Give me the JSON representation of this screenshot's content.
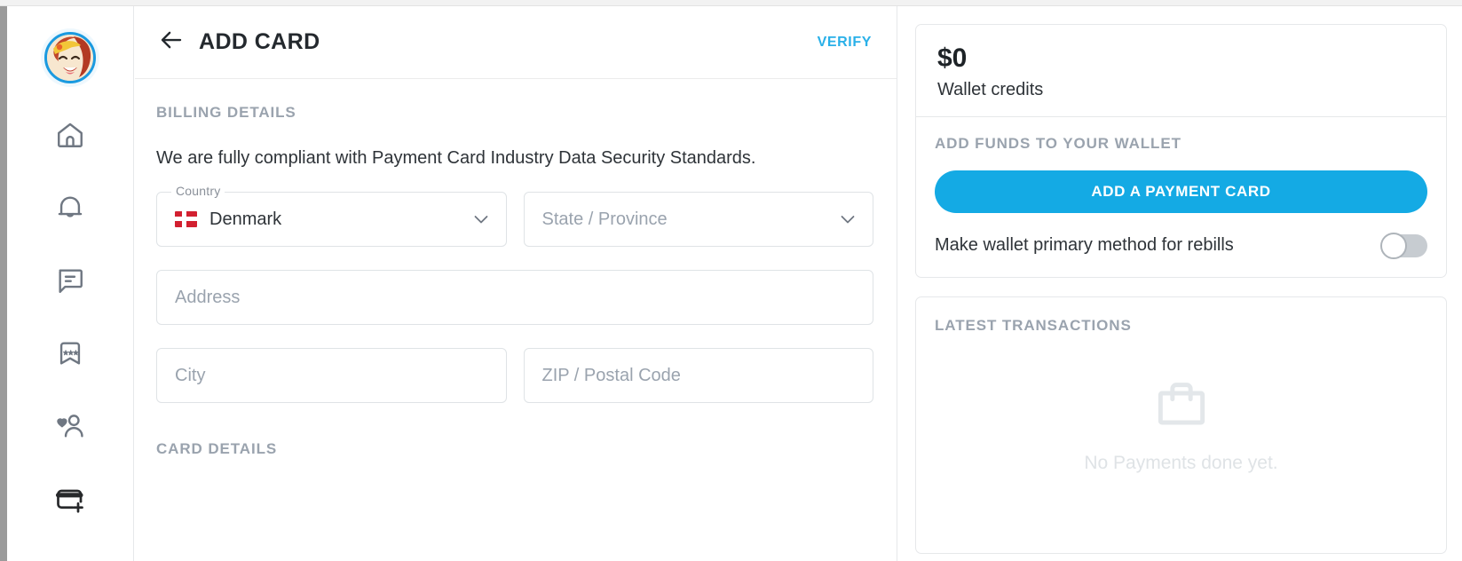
{
  "sidebar": {
    "avatar": {
      "name": "user-avatar",
      "alt": "User profile avatar"
    },
    "items": [
      {
        "icon": "home-icon",
        "name": "sidebar-item-home",
        "active": false
      },
      {
        "icon": "bell-icon",
        "name": "sidebar-item-notifications",
        "active": false
      },
      {
        "icon": "chat-icon",
        "name": "sidebar-item-messages",
        "active": false
      },
      {
        "icon": "bookmark-stars-icon",
        "name": "sidebar-item-favorites",
        "active": false
      },
      {
        "icon": "person-heart-icon",
        "name": "sidebar-item-friends",
        "active": false
      },
      {
        "icon": "credit-card-add-icon",
        "name": "sidebar-item-payments",
        "active": true
      }
    ]
  },
  "header": {
    "back_icon": "back-arrow-icon",
    "title": "ADD CARD",
    "verify_label": "VERIFY"
  },
  "billing": {
    "section_label": "BILLING DETAILS",
    "compliance_text": "We are fully compliant with Payment Card Industry Data Security Standards.",
    "country": {
      "label": "Country",
      "value": "Denmark",
      "flag": "denmark-flag-icon",
      "chevron": "chevron-down-icon"
    },
    "state": {
      "placeholder": "State / Province",
      "chevron": "chevron-down-icon"
    },
    "address": {
      "placeholder": "Address"
    },
    "city": {
      "placeholder": "City"
    },
    "zip": {
      "placeholder": "ZIP / Postal Code"
    },
    "card_details_label": "CARD DETAILS"
  },
  "wallet": {
    "amount": "$0",
    "credits_label": "Wallet credits",
    "add_funds_label": "ADD FUNDS TO YOUR WALLET",
    "add_card_button": "ADD A PAYMENT CARD",
    "primary_toggle_label": "Make wallet primary method for rebills",
    "primary_toggle_state": "off"
  },
  "transactions": {
    "heading": "LATEST TRANSACTIONS",
    "empty_icon": "shopping-bag-icon",
    "empty_text": "No Payments done yet."
  },
  "colors": {
    "accent_blue": "#14aae4",
    "link_blue": "#29b0e8",
    "muted_gray": "#9aa3ae",
    "border_gray": "#e6e8ea",
    "flag_red": "#d22030"
  }
}
